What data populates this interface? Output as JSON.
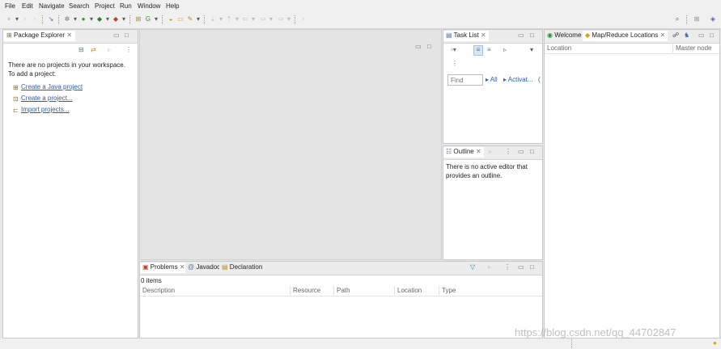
{
  "menu": [
    "File",
    "Edit",
    "Navigate",
    "Search",
    "Project",
    "Run",
    "Window",
    "Help"
  ],
  "package_explorer": {
    "title": "Package Explorer",
    "message_line1": "There are no projects in your workspace.",
    "message_line2": "To add a project:",
    "links": [
      "Create a Java project",
      "Create a project...",
      "Import projects..."
    ]
  },
  "task_list": {
    "title": "Task List",
    "find_placeholder": "Find",
    "filter_all": "All",
    "filter_activate": "Activat..."
  },
  "outline": {
    "title": "Outline",
    "message_line1": "There is no active editor that",
    "message_line2": "provides an outline."
  },
  "right_view": {
    "tabs": [
      "Welcome",
      "Map/Reduce Locations"
    ],
    "columns": [
      "Location",
      "Master node"
    ]
  },
  "bottom": {
    "tabs": [
      "Problems",
      "Javadoc",
      "Declaration"
    ],
    "count": "0 items",
    "columns": [
      "Description",
      "Resource",
      "Path",
      "Location",
      "Type"
    ]
  },
  "watermark": "https://blog.csdn.net/qq_44702847"
}
